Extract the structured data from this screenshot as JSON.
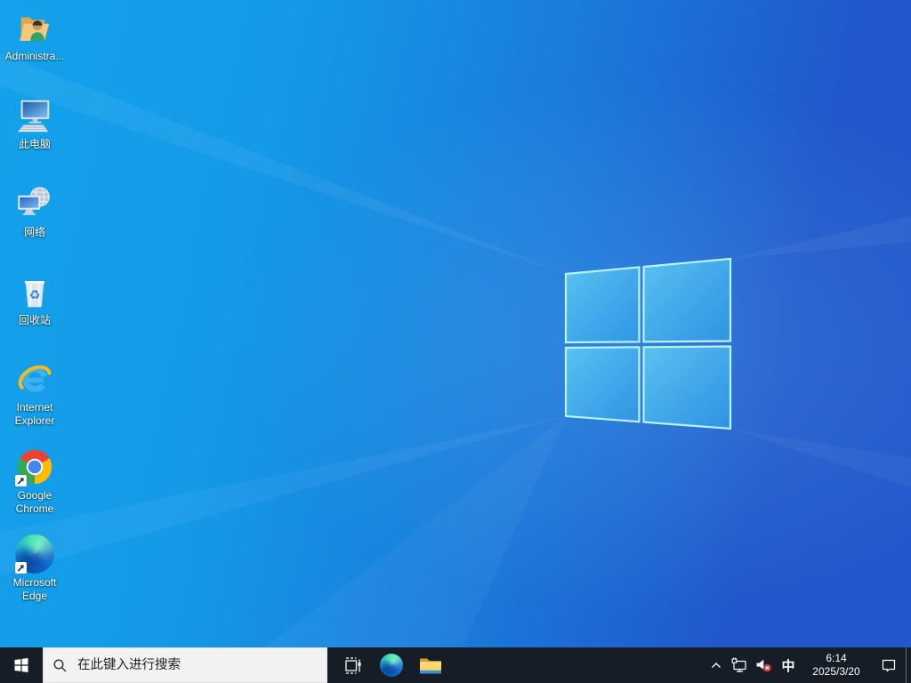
{
  "desktop_icons": [
    {
      "label": "Administra...",
      "icon": "user-folder"
    },
    {
      "label": "此电脑",
      "icon": "this-pc"
    },
    {
      "label": "网络",
      "icon": "network"
    },
    {
      "label": "回收站",
      "icon": "recycle-bin"
    },
    {
      "label": "Internet Explorer",
      "icon": "internet-explorer"
    },
    {
      "label": "Google Chrome",
      "icon": "google-chrome"
    },
    {
      "label": "Microsoft Edge",
      "icon": "microsoft-edge"
    }
  ],
  "taskbar": {
    "search": {
      "placeholder": "在此键入进行搜索"
    },
    "tray": {
      "ime": "中",
      "time": "6:14",
      "date": "2025/3/20"
    }
  },
  "icons": {
    "recycle_glyph": "♻"
  },
  "colors": {
    "wallpaper_light": "#13a2eb",
    "wallpaper_dark": "#2158cc",
    "logo_edge": "#b9f2fb",
    "taskbar_bg": "#151d26",
    "search_box_bg": "#f2f2f2",
    "volume_muted_badge": "#cc3a41",
    "chrome_red": "#ea4335",
    "chrome_yellow": "#fbbc05",
    "chrome_green": "#34a853",
    "chrome_blue": "#4285f4"
  }
}
